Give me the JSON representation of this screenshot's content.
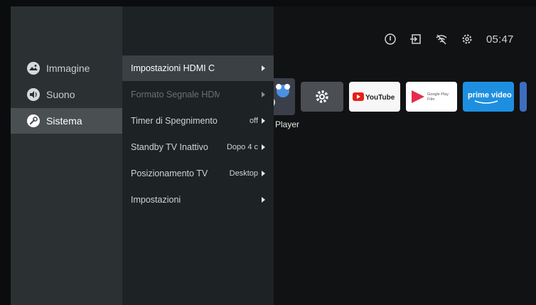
{
  "status_bar": {
    "time": "05:47",
    "icons": [
      "info-icon",
      "input-source-icon",
      "wifi-icon",
      "gear-icon"
    ]
  },
  "apps": [
    {
      "name": "player-app",
      "label": "Player"
    },
    {
      "name": "settings-app"
    },
    {
      "name": "youtube-app",
      "label": "YouTube"
    },
    {
      "name": "google-play-film-app",
      "label_top": "Google Play",
      "label_bottom": "Film"
    },
    {
      "name": "prime-video-app",
      "label": "prime video"
    }
  ],
  "categories": [
    {
      "label": "Immagine",
      "icon": "picture-icon",
      "active": false
    },
    {
      "label": "Suono",
      "icon": "sound-icon",
      "active": false
    },
    {
      "label": "Sistema",
      "icon": "wrench-icon",
      "active": true
    }
  ],
  "submenu": [
    {
      "label": "Impostazioni HDMI C",
      "value": "",
      "active": true,
      "disabled": false
    },
    {
      "label": "Formato Segnale HDM",
      "value": "",
      "active": false,
      "disabled": true
    },
    {
      "label": "Timer di Spegnimento",
      "value": "off",
      "active": false,
      "disabled": false
    },
    {
      "label": "Standby TV Inattivo",
      "value": "Dopo 4 c",
      "active": false,
      "disabled": false
    },
    {
      "label": "Posizionamento TV",
      "value": "Desktop",
      "active": false,
      "disabled": false
    },
    {
      "label": "Impostazioni",
      "value": "",
      "active": false,
      "disabled": false
    }
  ]
}
